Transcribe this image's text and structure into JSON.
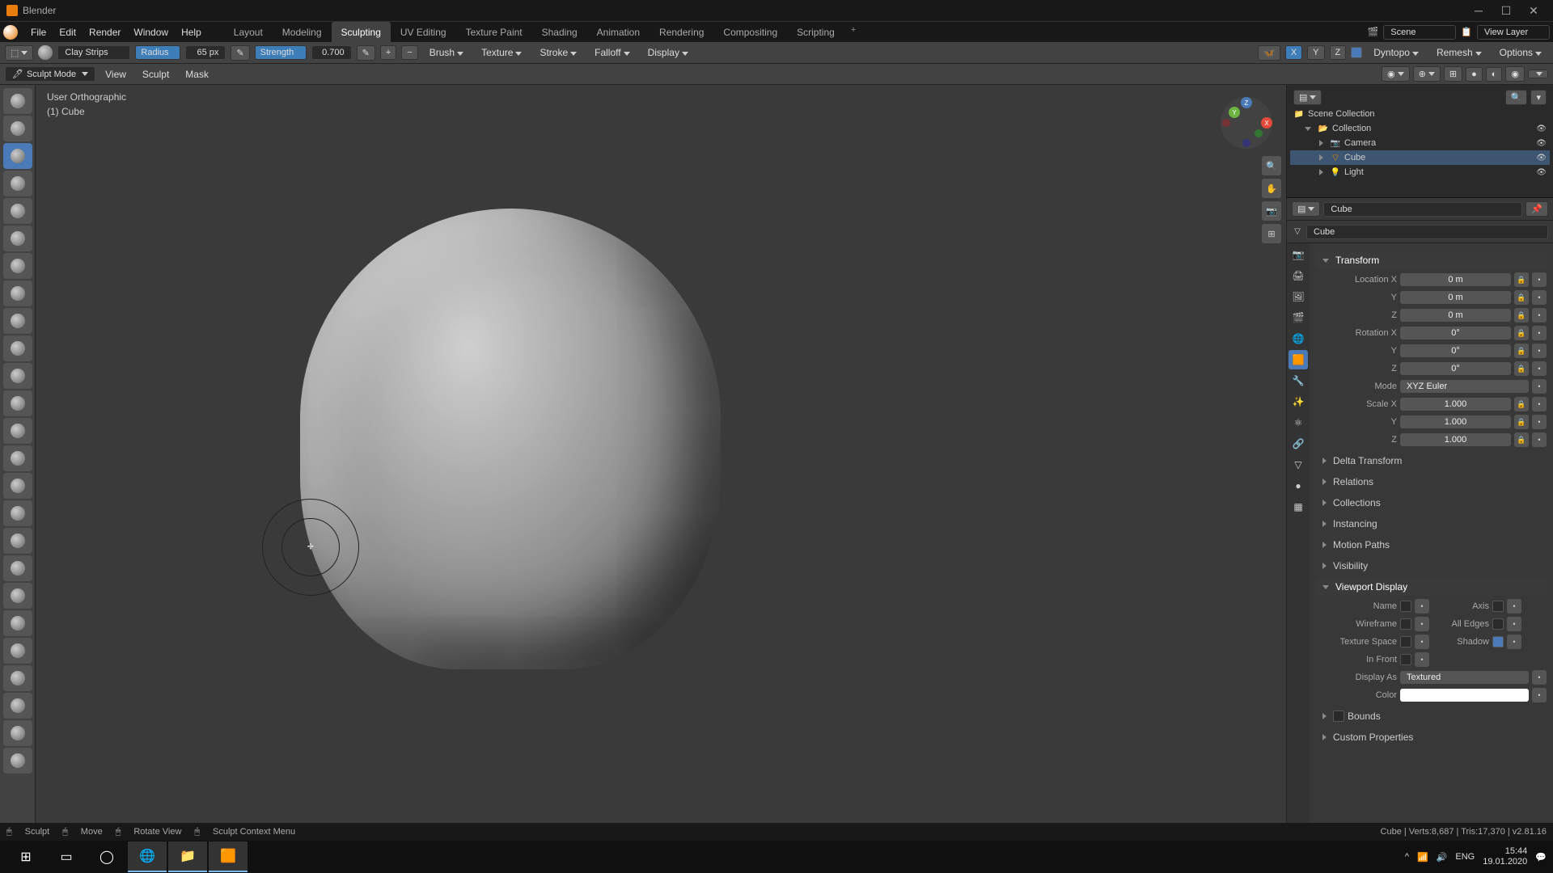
{
  "app_title": "Blender",
  "menus": [
    "File",
    "Edit",
    "Render",
    "Window",
    "Help"
  ],
  "workspaces": [
    "Layout",
    "Modeling",
    "Sculpting",
    "UV Editing",
    "Texture Paint",
    "Shading",
    "Animation",
    "Rendering",
    "Compositing",
    "Scripting"
  ],
  "active_workspace": "Sculpting",
  "scene_name": "Scene",
  "view_layer": "View Layer",
  "brush_name": "Clay Strips",
  "radius_label": "Radius",
  "radius_value": "65 px",
  "strength_label": "Strength",
  "strength_value": "0.700",
  "header_menus": [
    "Brush",
    "Texture",
    "Stroke",
    "Falloff",
    "Display"
  ],
  "mirror_axes": [
    "X",
    "Y",
    "Z"
  ],
  "dyntopo": "Dyntopo",
  "remesh": "Remesh",
  "options": "Options",
  "mode": "Sculpt Mode",
  "sub_menus": [
    "View",
    "Sculpt",
    "Mask"
  ],
  "vp_line1": "User Orthographic",
  "vp_line2": "(1) Cube",
  "outliner": {
    "root": "Scene Collection",
    "collection": "Collection",
    "items": [
      "Camera",
      "Cube",
      "Light"
    ]
  },
  "obj_name": "Cube",
  "transform": {
    "title": "Transform",
    "loc_label": "Location X",
    "loc": [
      "0 m",
      "0 m",
      "0 m"
    ],
    "rot_label": "Rotation X",
    "rot": [
      "0°",
      "0°",
      "0°"
    ],
    "mode_label": "Mode",
    "mode": "XYZ Euler",
    "scale_label": "Scale X",
    "scale": [
      "1.000",
      "1.000",
      "1.000"
    ]
  },
  "panels": {
    "delta": "Delta Transform",
    "relations": "Relations",
    "collections": "Collections",
    "instancing": "Instancing",
    "motion": "Motion Paths",
    "visibility": "Visibility",
    "viewport": "Viewport Display",
    "bounds": "Bounds",
    "custom": "Custom Properties"
  },
  "vp_display": {
    "name": "Name",
    "axis": "Axis",
    "wireframe": "Wireframe",
    "all_edges": "All Edges",
    "tex_space": "Texture Space",
    "shadow": "Shadow",
    "in_front": "In Front",
    "display_as_label": "Display As",
    "display_as": "Textured",
    "color": "Color"
  },
  "status": {
    "sculpt": "Sculpt",
    "move": "Move",
    "rotate": "Rotate View",
    "context": "Sculpt Context Menu",
    "stats": "Cube | Verts:8,687 | Tris:17,370 | v2.81.16"
  },
  "taskbar": {
    "lang": "ENG",
    "time": "15:44",
    "date": "19.01.2020"
  }
}
